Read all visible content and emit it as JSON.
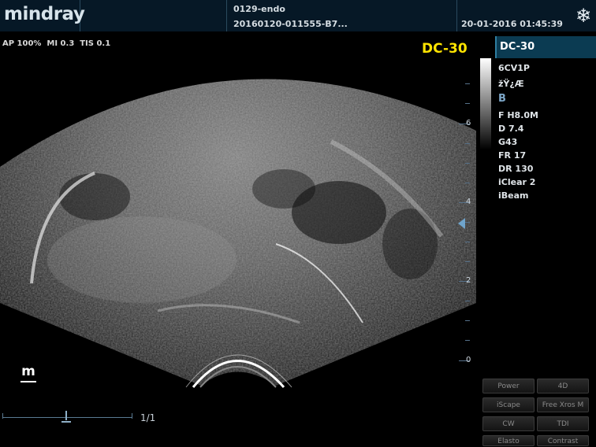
{
  "header": {
    "logo": "mindray",
    "patient_id": "0129-endo",
    "exam_id": "20160120-011555-B7...",
    "datetime": "20-01-2016 01:45:39",
    "freeze_icon": "snowflake-icon"
  },
  "image_params": "AP 100%  MI 0.3  TIS 0.1",
  "probe_label": "DC-30",
  "side_panel": {
    "device": "DC-30",
    "items": [
      "6CV1P",
      "žŸ¿Æ",
      "B",
      "F H8.0M",
      "D 7.4",
      "G43",
      "FR 17",
      "DR 130",
      "iClear 2",
      "iBeam"
    ]
  },
  "depth_scale": {
    "labels": [
      "6",
      "4",
      "2",
      "0"
    ]
  },
  "cine": {
    "counter": "1/1"
  },
  "buttons": {
    "power": "Power",
    "4d": "4D",
    "iscape": "iScape",
    "free_xros_m": "Free Xros M",
    "cw": "CW",
    "tdi": "TDI",
    "elasto": "Elasto",
    "contrast": "Contrast"
  },
  "colors": {
    "probe_label": "#ffe400",
    "header_bg": "#061826",
    "side_accent": "#0b3b52"
  }
}
